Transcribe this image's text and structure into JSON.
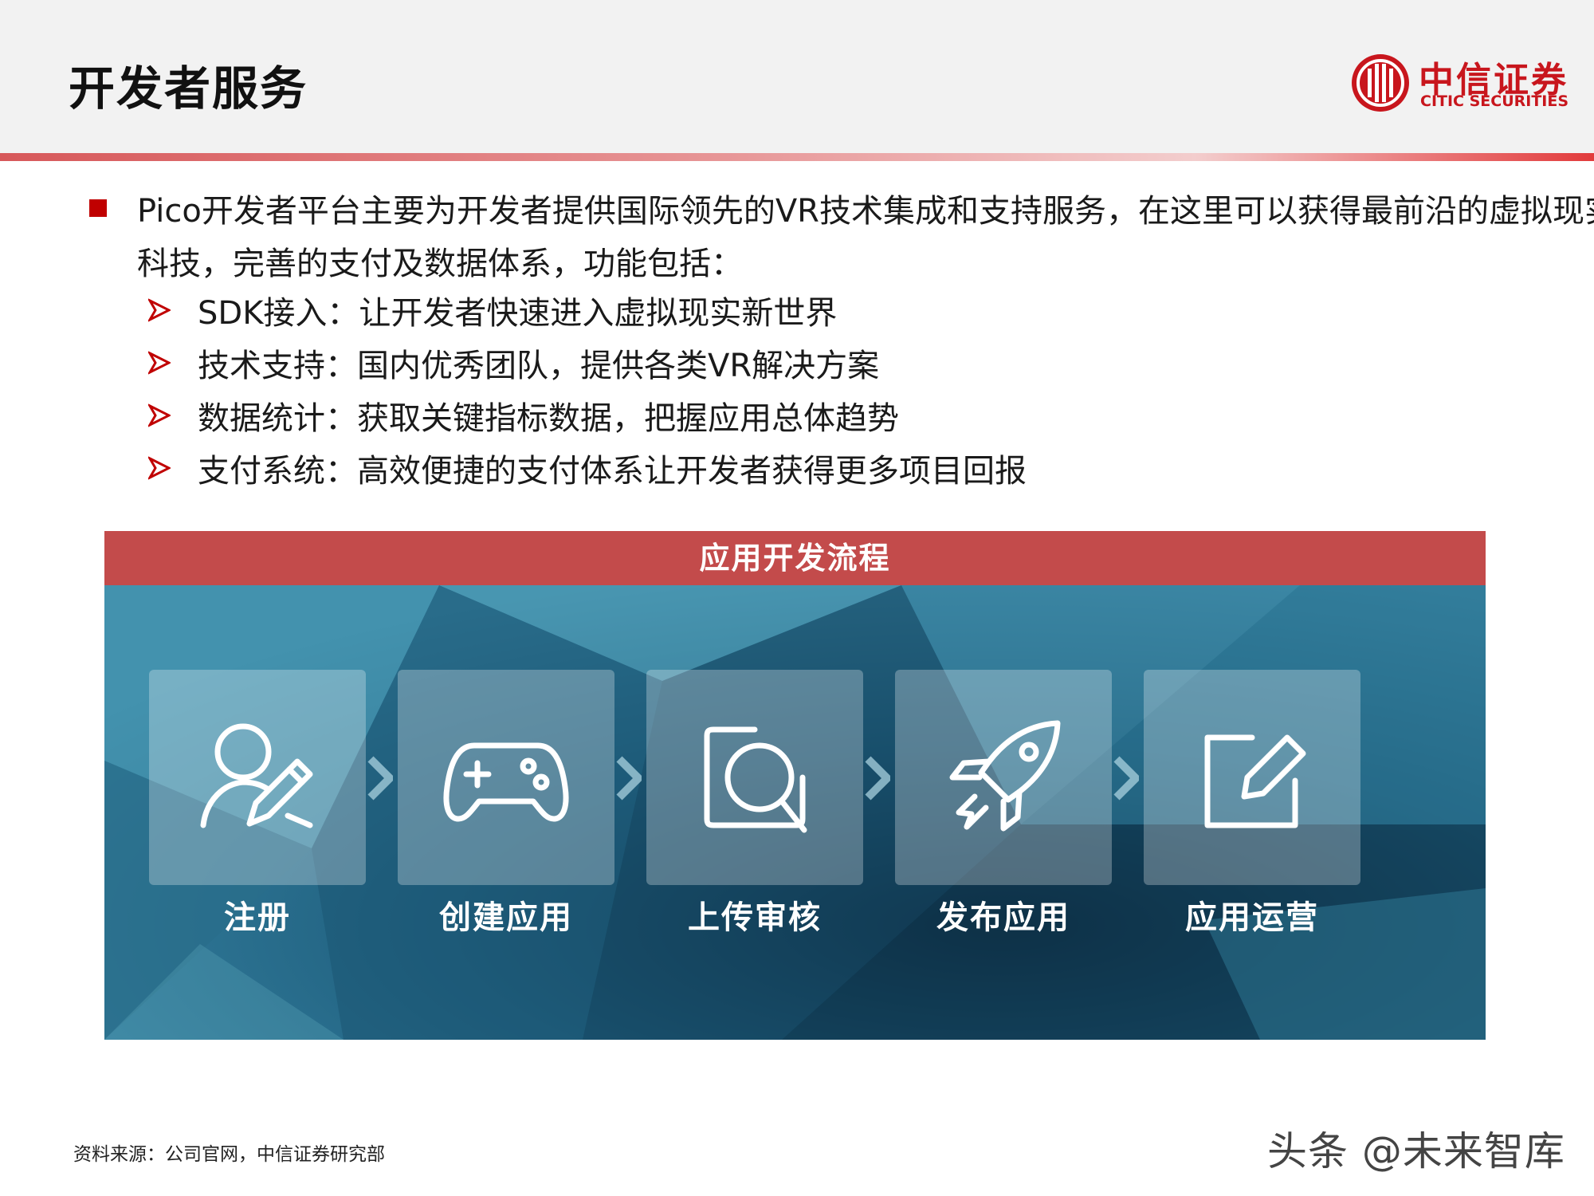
{
  "header": {
    "title": "开发者服务",
    "logo": {
      "cn": "中信证券",
      "en": "CITIC SECURITIES",
      "color": "#c8161d"
    }
  },
  "intro": {
    "text": "Pico开发者平台主要为开发者提供国际领先的VR技术集成和支持服务，在这里可以获得最前沿的虚拟现实科技，完善的支付及数据体系，功能包括："
  },
  "features": [
    "SDK接入：让开发者快速进入虚拟现实新世界",
    "技术支持：国内优秀团队，提供各类VR解决方案",
    "数据统计：获取关键指标数据，把握应用总体趋势",
    "支付系统：高效便捷的支付体系让开发者获得更多项目回报"
  ],
  "process": {
    "title": "应用开发流程",
    "steps": [
      {
        "label": "注册",
        "icon": "user-edit-icon"
      },
      {
        "label": "创建应用",
        "icon": "gamepad-icon"
      },
      {
        "label": "上传审核",
        "icon": "search-review-icon"
      },
      {
        "label": "发布应用",
        "icon": "rocket-icon"
      },
      {
        "label": "应用运营",
        "icon": "edit-square-icon"
      }
    ]
  },
  "source": "资料来源：公司官网，中信证券研究部",
  "watermark": "头条 @未来智库",
  "colors": {
    "accent": "#c00000",
    "panel_header": "#c34b4b"
  }
}
